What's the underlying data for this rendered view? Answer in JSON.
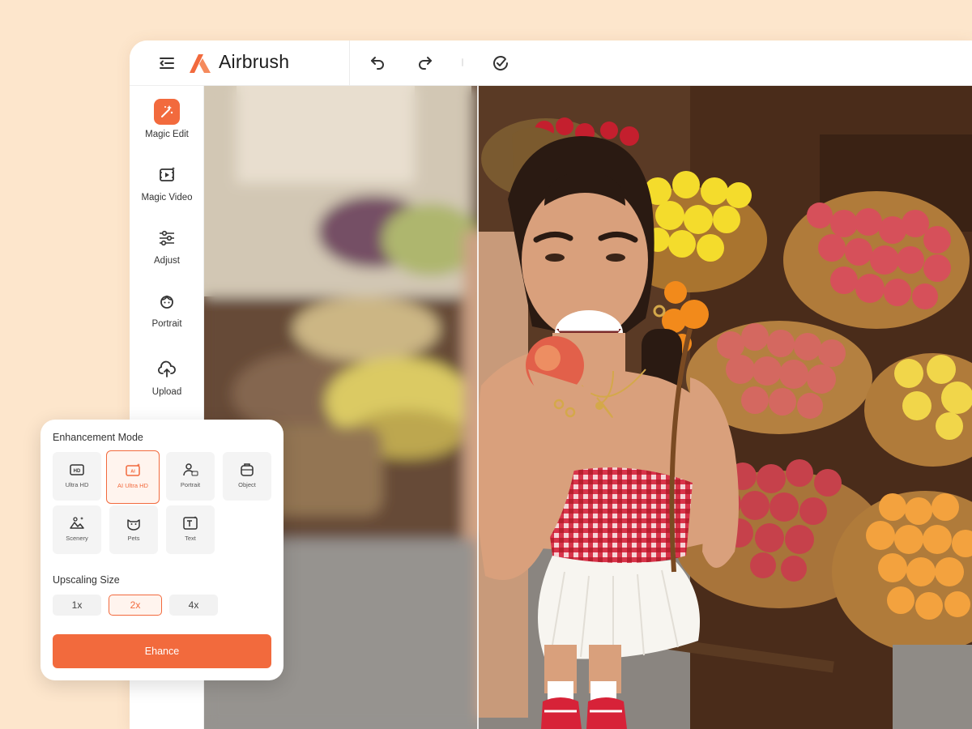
{
  "app": {
    "name": "Airbrush",
    "accent": "#f26a3d",
    "background": "#fde6cc"
  },
  "toolbar": {
    "icons": [
      "menu-collapse-icon",
      "undo-icon",
      "redo-icon",
      "check-circle-icon"
    ]
  },
  "sidebar": {
    "items": [
      {
        "label": "Magic Edit",
        "icon": "magic-wand-icon",
        "active": true
      },
      {
        "label": "Magic Video",
        "icon": "video-sparkle-icon",
        "active": false
      },
      {
        "label": "Adjust",
        "icon": "sliders-icon",
        "active": false
      },
      {
        "label": "Portrait",
        "icon": "face-icon",
        "active": false
      },
      {
        "label": "Upload",
        "icon": "upload-icon",
        "active": false
      }
    ]
  },
  "panel": {
    "mode_title": "Enhancement Mode",
    "modes": [
      {
        "label": "Ultra HD",
        "icon": "hd-icon",
        "selected": false
      },
      {
        "label": "AI Ultra HD",
        "icon": "ai-hd-icon",
        "selected": true
      },
      {
        "label": "Portrait",
        "icon": "person-hd-icon",
        "selected": false
      },
      {
        "label": "Object",
        "icon": "object-icon",
        "selected": false
      },
      {
        "label": "Scenery",
        "icon": "scenery-icon",
        "selected": false
      },
      {
        "label": "Pets",
        "icon": "cat-icon",
        "selected": false
      },
      {
        "label": "Text",
        "icon": "text-icon",
        "selected": false
      }
    ],
    "size_title": "Upscaling Size",
    "sizes": [
      {
        "label": "1x",
        "selected": false
      },
      {
        "label": "2x",
        "selected": true
      },
      {
        "label": "4x",
        "selected": false
      }
    ],
    "action_label": "Ehance"
  },
  "canvas": {
    "image": "woman-eating-peach-at-fruit-market-photo",
    "comparison": "before-blurred-left-after-sharp-right"
  }
}
